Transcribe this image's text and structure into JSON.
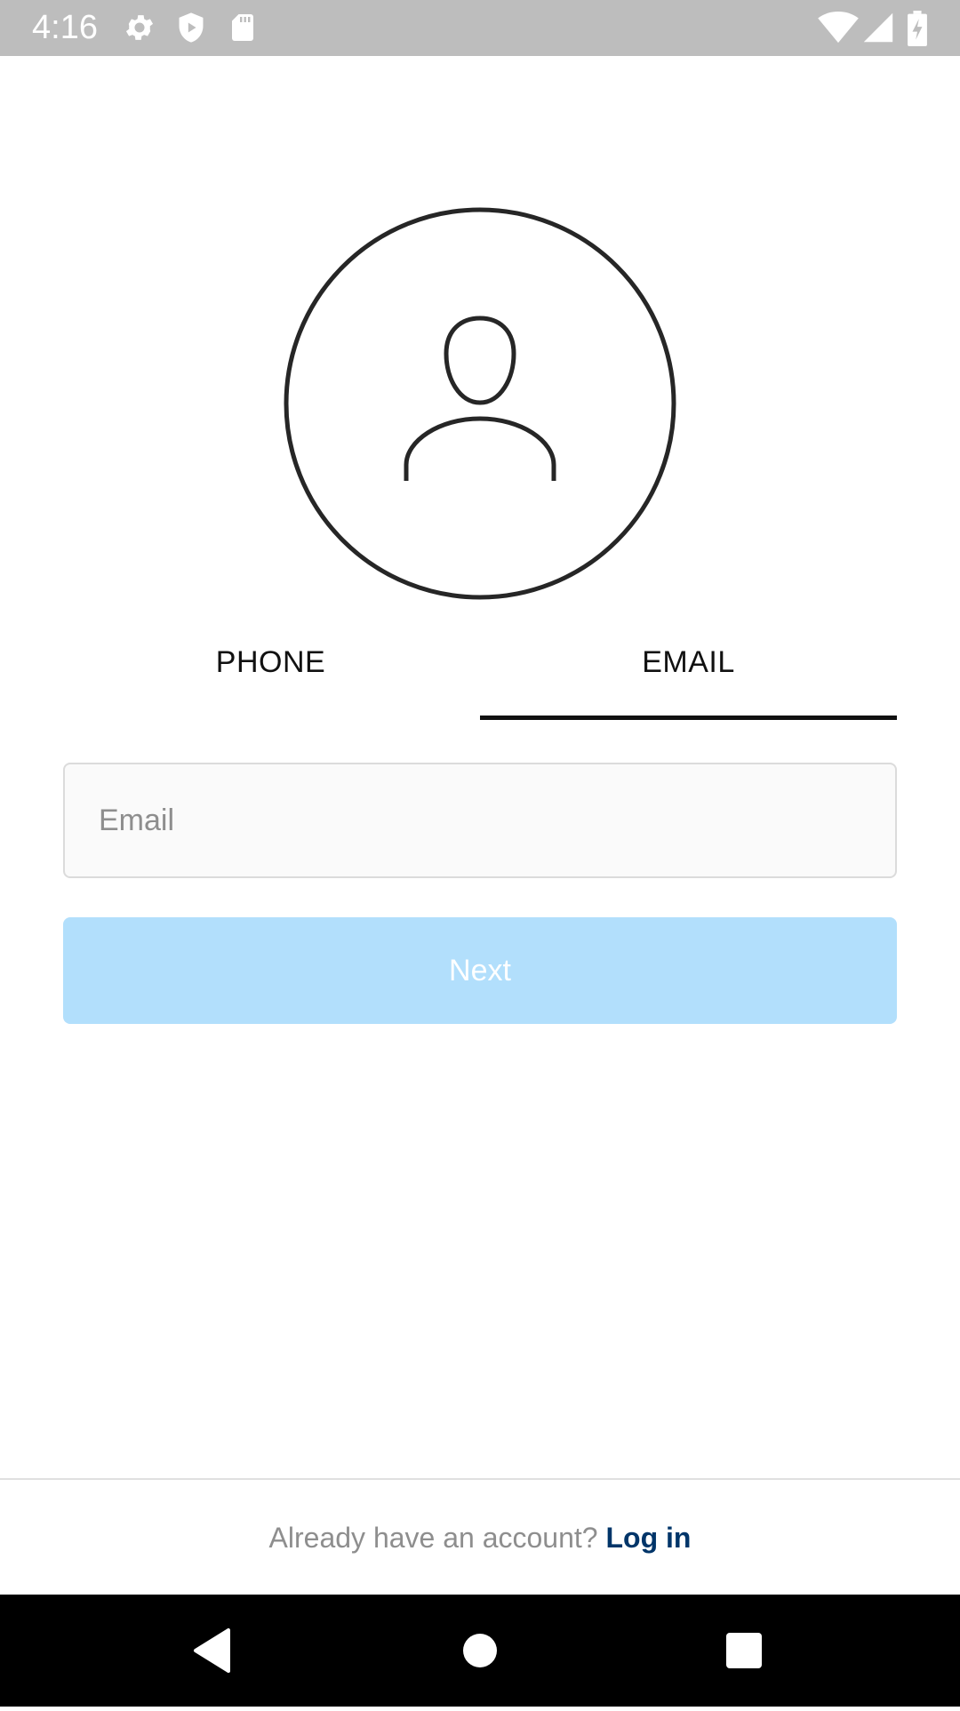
{
  "status_bar": {
    "time": "4:16",
    "left_icons": [
      "gear-icon",
      "shield-icon",
      "sd-card-icon"
    ],
    "right_icons": [
      "wifi-icon",
      "signal-icon",
      "battery-charging-icon"
    ]
  },
  "avatar": {
    "icon": "person-outline-icon"
  },
  "tabs": [
    {
      "label": "PHONE",
      "active": false
    },
    {
      "label": "EMAIL",
      "active": true
    }
  ],
  "form": {
    "email_placeholder": "Email",
    "email_value": "",
    "next_label": "Next",
    "next_enabled": false
  },
  "footer": {
    "prompt": "Already have an account?",
    "login_label": "Log in"
  },
  "nav_bar": {
    "buttons": [
      "back-icon",
      "home-icon",
      "recents-icon"
    ]
  },
  "colors": {
    "status_bar_bg": "#bdbdbd",
    "next_button_bg": "#b2dffc",
    "login_link": "#003569",
    "field_bg": "#fafafa",
    "field_border": "#dbdbdb",
    "nav_bar_bg": "#000000"
  }
}
